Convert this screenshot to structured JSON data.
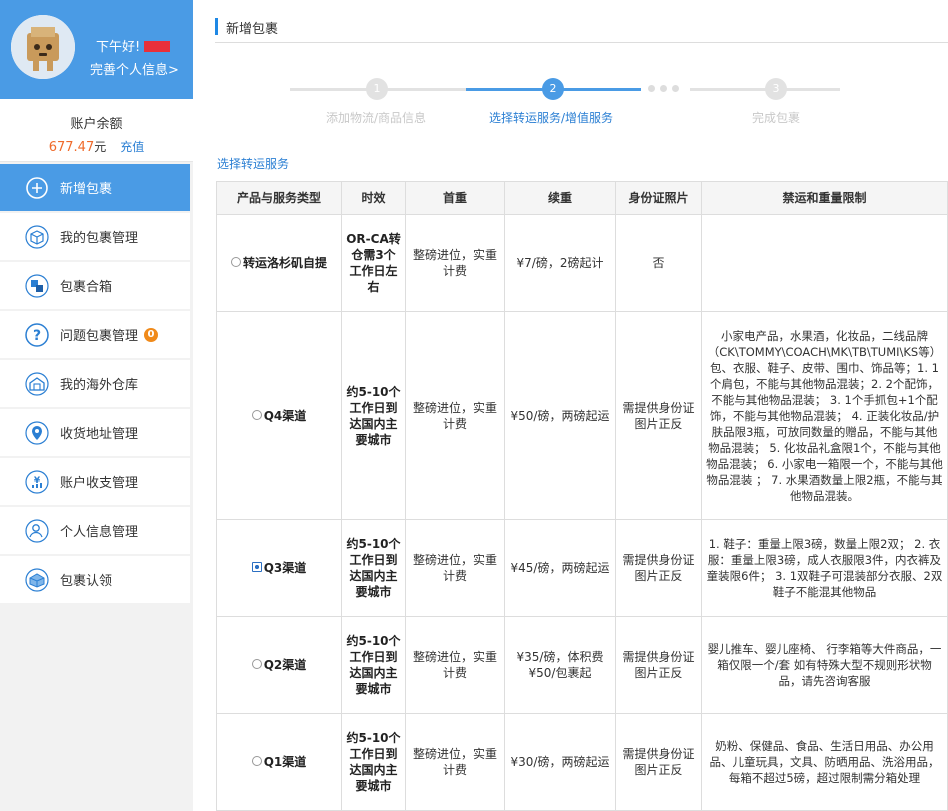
{
  "profile": {
    "greeting": "下午好!",
    "complete_link": "完善个人信息>"
  },
  "balance": {
    "label": "账户余额",
    "amount": "677.47",
    "unit": "元",
    "recharge": "充值"
  },
  "menu": [
    {
      "label": "新增包裹",
      "icon": "plus-circle-icon",
      "active": true
    },
    {
      "label": "我的包裹管理",
      "icon": "package-icon"
    },
    {
      "label": "包裹合箱",
      "icon": "merge-boxes-icon"
    },
    {
      "label": "问题包裹管理",
      "icon": "question-icon",
      "badge": "0"
    },
    {
      "label": "我的海外仓库",
      "icon": "warehouse-icon"
    },
    {
      "label": "收货地址管理",
      "icon": "location-pin-icon"
    },
    {
      "label": "账户收支管理",
      "icon": "ledger-icon"
    },
    {
      "label": "个人信息管理",
      "icon": "user-icon"
    },
    {
      "label": "包裹认领",
      "icon": "claim-package-icon"
    }
  ],
  "page": {
    "title": "新增包裹",
    "section_title": "选择转运服务"
  },
  "steps": [
    {
      "num": "1",
      "label": "添加物流/商品信息"
    },
    {
      "num": "2",
      "label": "选择转运服务/增值服务"
    },
    {
      "num": "3",
      "label": "完成包裹"
    }
  ],
  "colors": {
    "accent": "#4a9be5",
    "link": "#2b7fd3",
    "amount": "#ef6a2a",
    "step_inactive": "#dddddd"
  },
  "table": {
    "headers": [
      "产品与服务类型",
      "时效",
      "首重",
      "续重",
      "身份证照片",
      "禁运和重量限制"
    ],
    "rows": [
      {
        "name": "转运洛杉矶自提",
        "checked": false,
        "time": "OR-CA转仓需3个工作日左右",
        "first": "整磅进位，实重计费",
        "additional": "¥7/磅，2磅起计",
        "id_photo": "否",
        "restriction": ""
      },
      {
        "name": "Q4渠道",
        "checked": false,
        "time": "约5-10个工作日到达国内主要城市",
        "first": "整磅进位，实重计费",
        "additional": "¥50/磅，两磅起运",
        "id_photo": "需提供身份证图片正反",
        "restriction": "小家电产品，水果酒，化妆品，二线品牌（CK\\TOMMY\\COACH\\MK\\TB\\TUMI\\KS等）包、衣服、鞋子、皮带、围巾、饰品等；1. 1个肩包，不能与其他物品混装；2. 2个配饰，不能与其他物品混装； 3. 1个手抓包+1个配饰，不能与其他物品混装； 4. 正装化妆品/护肤品限3瓶，可放同数量的赠品，不能与其他物品混装； 5. 化妆品礼盒限1个，不能与其他物品混装； 6. 小家电一箱限一个，不能与其他物品混装 ； 7. 水果酒数量上限2瓶，不能与其他物品混装。"
      },
      {
        "name": "Q3渠道",
        "checked": true,
        "time": "约5-10个工作日到达国内主要城市",
        "first": "整磅进位，实重计费",
        "additional": "¥45/磅，两磅起运",
        "id_photo": "需提供身份证图片正反",
        "restriction": "1. 鞋子：重量上限3磅，数量上限2双； 2. 衣服：重量上限3磅，成人衣服限3件，内衣裤及童装限6件； 3. 1双鞋子可混装部分衣服、2双鞋子不能混其他物品"
      },
      {
        "name": "Q2渠道",
        "checked": false,
        "time": "约5-10个工作日到达国内主要城市",
        "first": "整磅进位，实重计费",
        "additional": "¥35/磅，体积费¥50/包裹起",
        "id_photo": "需提供身份证图片正反",
        "restriction": "婴儿推车、婴儿座椅、 行李箱等大件商品，一箱仅限一个/套 如有特殊大型不规则形状物品，请先咨询客服"
      },
      {
        "name": "Q1渠道",
        "checked": false,
        "time": "约5-10个工作日到达国内主要城市",
        "first": "整磅进位，实重计费",
        "additional": "¥30/磅，两磅起运",
        "id_photo": "需提供身份证图片正反",
        "restriction": "奶粉、保健品、食品、生活日用品、办公用品、儿童玩具，文具、防晒用品、洗浴用品， 每箱不超过5磅，超过限制需分箱处理"
      }
    ]
  }
}
